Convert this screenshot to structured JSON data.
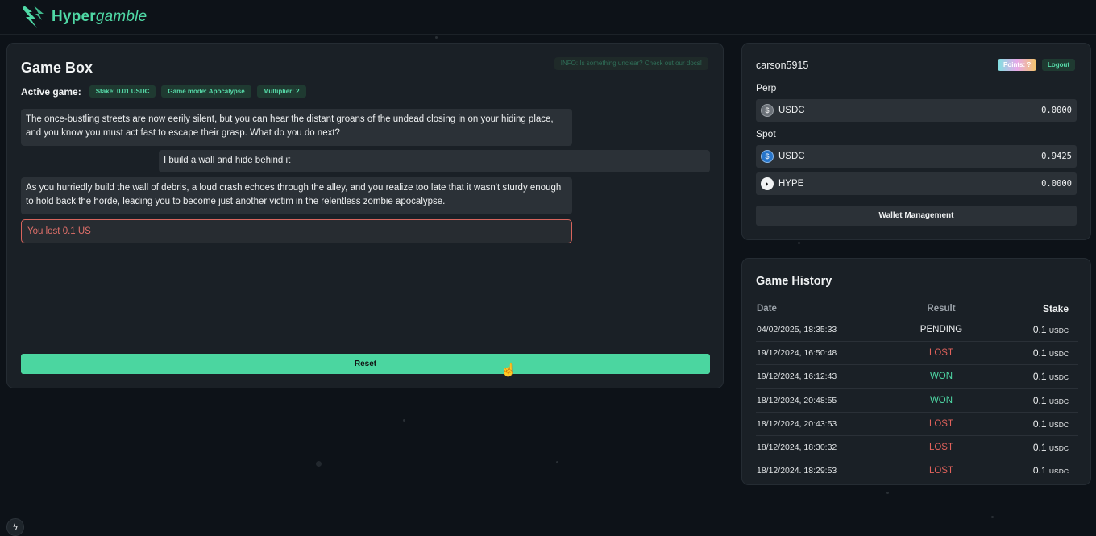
{
  "header": {
    "brand_bold": "Hyper",
    "brand_italic": "gamble"
  },
  "game_box": {
    "title": "Game Box",
    "info": "INFO: Is something unclear? Check out our docs!",
    "active_label": "Active game:",
    "badges": [
      "Stake: 0.01 USDC",
      "Game mode: Apocalypse",
      "Multiplier: 2"
    ],
    "messages": [
      "The once-bustling streets are now eerily silent, but you can hear the distant groans of the undead closing in on your hiding place, and you know you must act fast to escape their grasp. What do you do next?",
      "I build a wall and hide behind it",
      "As you hurriedly build the wall of debris, a loud crash echoes through the alley, and you realize too late that it wasn't sturdy enough to hold back the horde, leading you to become just another victim in the relentless zombie apocalypse."
    ],
    "result_text": "You lost 0.1 US",
    "reset_label": "Reset"
  },
  "account": {
    "username": "carson5915",
    "points_label": "Points: ?",
    "logout_label": "Logout",
    "perp_label": "Perp",
    "spot_label": "Spot",
    "perp": [
      {
        "coin": "USDC",
        "value": "0.0000",
        "icon": "usdc-grey-icon"
      }
    ],
    "spot": [
      {
        "coin": "USDC",
        "value": "0.9425",
        "icon": "usdc-icon"
      },
      {
        "coin": "HYPE",
        "value": "0.0000",
        "icon": "hype-icon"
      }
    ],
    "wallet_button": "Wallet Management"
  },
  "history": {
    "title": "Game History",
    "columns": [
      "Date",
      "Result",
      "Stake"
    ],
    "rows": [
      {
        "date": "04/02/2025, 18:35:33",
        "result": "PENDING",
        "stake": "0.1",
        "unit": "USDC"
      },
      {
        "date": "19/12/2024, 16:50:48",
        "result": "LOST",
        "stake": "0.1",
        "unit": "USDC"
      },
      {
        "date": "19/12/2024, 16:12:43",
        "result": "WON",
        "stake": "0.1",
        "unit": "USDC"
      },
      {
        "date": "18/12/2024, 20:48:55",
        "result": "WON",
        "stake": "0.1",
        "unit": "USDC"
      },
      {
        "date": "18/12/2024, 20:43:53",
        "result": "LOST",
        "stake": "0.1",
        "unit": "USDC"
      },
      {
        "date": "18/12/2024, 18:30:32",
        "result": "LOST",
        "stake": "0.1",
        "unit": "USDC"
      },
      {
        "date": "18/12/2024, 18:29:53",
        "result": "LOST",
        "stake": "0.1",
        "unit": "USDC"
      }
    ]
  },
  "colors": {
    "accent": "#4bd6a0",
    "lost": "#e2625c",
    "background": "#0d1218"
  }
}
